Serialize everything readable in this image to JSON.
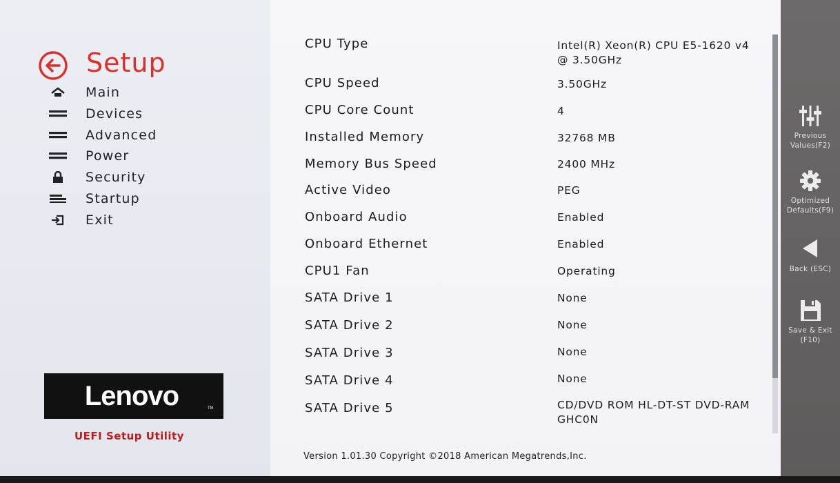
{
  "sidebar": {
    "title": "Setup",
    "items": [
      {
        "label": "Main",
        "icon": "home-icon"
      },
      {
        "label": "Devices",
        "icon": "bars-icon"
      },
      {
        "label": "Advanced",
        "icon": "bars-icon"
      },
      {
        "label": "Power",
        "icon": "bars-icon"
      },
      {
        "label": "Security",
        "icon": "lock-icon"
      },
      {
        "label": "Startup",
        "icon": "startup-icon"
      },
      {
        "label": "Exit",
        "icon": "exit-icon"
      }
    ],
    "brand": "Lenovo",
    "utility_name": "UEFI Setup Utility"
  },
  "main": {
    "rows": [
      {
        "label": "CPU Type",
        "value": "Intel(R) Xeon(R) CPU E5-1620 v4 @ 3.50GHz"
      },
      {
        "label": "CPU Speed",
        "value": "3.50GHz"
      },
      {
        "label": "CPU Core Count",
        "value": "4"
      },
      {
        "label": "Installed Memory",
        "value": "32768 MB"
      },
      {
        "label": "Memory Bus Speed",
        "value": "2400 MHz"
      },
      {
        "label": "Active Video",
        "value": "PEG"
      },
      {
        "label": "Onboard Audio",
        "value": "Enabled"
      },
      {
        "label": "Onboard Ethernet",
        "value": "Enabled"
      },
      {
        "label": "CPU1 Fan",
        "value": "Operating"
      },
      {
        "label": "SATA Drive 1",
        "value": "None"
      },
      {
        "label": "SATA Drive 2",
        "value": "None"
      },
      {
        "label": "SATA Drive 3",
        "value": "None"
      },
      {
        "label": "SATA Drive 4",
        "value": "None"
      },
      {
        "label": "SATA Drive 5",
        "value": "CD/DVD ROM HL-DT-ST DVD-RAM GHC0N"
      }
    ],
    "version": "Version 1.01.30 Copyright ©2018 American Megatrends,Inc."
  },
  "fkeys": [
    {
      "label": "Previous Values(F2)",
      "icon": "sliders-icon"
    },
    {
      "label": "Optimized Defaults(F9)",
      "icon": "gear-icon"
    },
    {
      "label": "Back (ESC)",
      "icon": "back-arrow-icon"
    },
    {
      "label": "Save & Exit (F10)",
      "icon": "save-icon"
    }
  ],
  "colors": {
    "accent": "#d8322e",
    "utility_red": "#b8201e",
    "sidebar_bg": "#e9ebf1",
    "fkey_bg": "#6a6667"
  }
}
